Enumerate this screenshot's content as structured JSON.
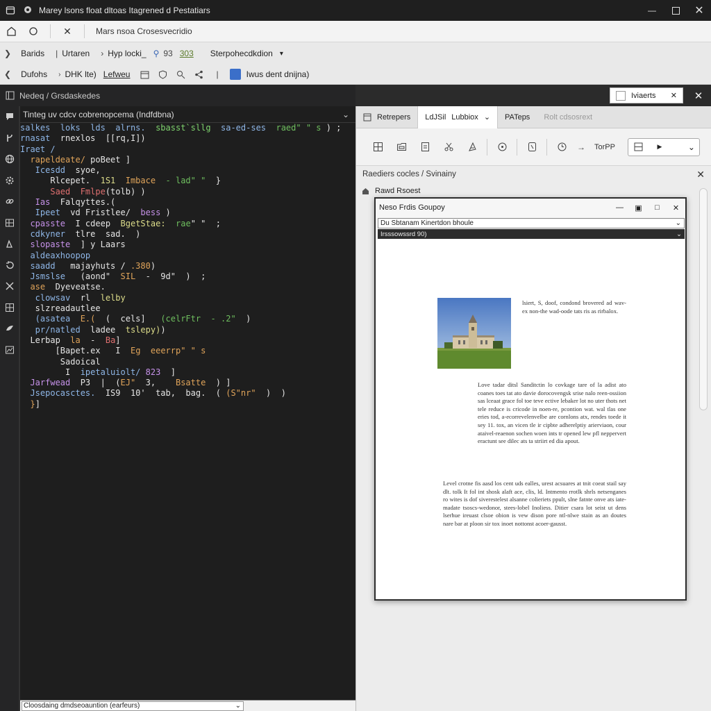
{
  "window": {
    "title": "Marey lsons float dltoas Itagrened d Pestatiars"
  },
  "address": {
    "text": "Mars nsoa Crosesvecridio"
  },
  "breadcrumb1": [
    "Barids",
    "Urtaren",
    "Hyp locki_",
    "93",
    "303",
    "Sterpohecdkdion"
  ],
  "breadcrumb2": {
    "first": "Dufohs",
    "second": "DHK lte)",
    "link": "Lefweu",
    "right": "Iwus dent dnijna)"
  },
  "explorer_header": "Nedeq / Grsdaskedes",
  "search_chip": {
    "label": "Iviaerts"
  },
  "editor": {
    "tab_title": "Tinteg uv cdcv cobrenopcema (Indfdbna)",
    "bottom_select": "Cloosdaing dmdseoauntion (earfeurs)"
  },
  "code_lines": [
    [
      [
        "k",
        "salkes  loks  lds  alrns.  "
      ],
      [
        "s",
        "sbasst`sllg  "
      ],
      [
        "k",
        "sa-ed-ses  "
      ],
      [
        "g",
        "raed\" \" s "
      ],
      [
        "w",
        ") ;"
      ]
    ],
    [
      [
        "k",
        "rnasat  "
      ],
      [
        "w",
        "rnexlos  [[rq,I])"
      ]
    ],
    [
      [
        "k",
        "Iraet /"
      ]
    ],
    [
      [
        "o",
        "  rapeldeate/ "
      ],
      [
        "w",
        "poBeet ]"
      ]
    ],
    [
      [
        "k",
        "   Icesdd  "
      ],
      [
        "w",
        "syoe,"
      ]
    ],
    [
      [
        "w",
        "      Rlcepet.  "
      ],
      [
        "y",
        "1S1  "
      ],
      [
        "o",
        "Imbace"
      ],
      [
        "g",
        "  - lad\" \"  "
      ],
      [
        "w",
        "}"
      ]
    ],
    [
      [
        "r",
        "      Saed  Fmlpe"
      ],
      [
        "w",
        "(tolb) )"
      ]
    ],
    [
      [
        "p",
        "   Ias  "
      ],
      [
        "w",
        "Falqyttes.("
      ]
    ],
    [
      [
        "k",
        "   Ipeet  "
      ],
      [
        "w",
        "vd Fristlee/  "
      ],
      [
        "p",
        "bess"
      ],
      [
        "w",
        " )"
      ]
    ],
    [
      [
        "p",
        "  cpasste  "
      ],
      [
        "w",
        "I cdeep  "
      ],
      [
        "y",
        "BgetStae:  "
      ],
      [
        "g",
        "rae"
      ],
      [
        "w",
        "\" \"  ;"
      ]
    ],
    [
      [
        "k",
        "  cdkyner  "
      ],
      [
        "w",
        "tlre  sad.  )"
      ]
    ],
    [
      [
        "p",
        "  slopaste  "
      ],
      [
        "w",
        "] y Laars"
      ]
    ],
    [
      [
        "k",
        "  aldeaxhoopop"
      ]
    ],
    [
      [
        "k",
        "  saadd   "
      ],
      [
        "w",
        "majayhuts / "
      ],
      [
        "o",
        ".380"
      ],
      [
        "w",
        ")"
      ]
    ],
    [
      [
        "k",
        "  Jsmslse   "
      ],
      [
        "w",
        "(aond\"  "
      ],
      [
        "o",
        "SIL  "
      ],
      [
        "w",
        "-  9d\"  )  ;"
      ]
    ],
    [
      [
        "o",
        "  ase  "
      ],
      [
        "w",
        "Dyeveatse."
      ]
    ],
    [
      [
        "k",
        "   clowsav  "
      ],
      [
        "w",
        "rl  "
      ],
      [
        "y",
        "lelby"
      ]
    ],
    [
      [
        "w",
        "   slzreadautlee"
      ]
    ],
    [
      [
        "k",
        "   (asatea  "
      ],
      [
        "o",
        "E.(  "
      ],
      [
        "w",
        "(  cels]   "
      ],
      [
        "g",
        "(celrFtr  - .2\"  "
      ],
      [
        "w",
        ")"
      ]
    ],
    [
      [
        "k",
        "   pr/natled  "
      ],
      [
        "w",
        "ladee  "
      ],
      [
        "y",
        "tslepy)"
      ],
      [
        "w",
        ")"
      ]
    ],
    [
      [
        "w",
        "  Lerbap  "
      ],
      [
        "o",
        "la  "
      ],
      [
        "w",
        "-  "
      ],
      [
        "r",
        "Ba"
      ],
      [
        "w",
        "]"
      ]
    ],
    [
      [
        "w",
        "       [Bapet.ex   "
      ],
      [
        "w",
        "I  "
      ],
      [
        "o",
        "Eg  "
      ],
      [
        "o",
        "eeerrp\" \" s"
      ]
    ],
    [
      [
        "w",
        "        Sadoical"
      ]
    ],
    [
      [
        "w",
        "         I  "
      ],
      [
        "k",
        "ipetaluiolt/ "
      ],
      [
        "p",
        "823  "
      ],
      [
        "w",
        "]"
      ]
    ],
    [
      [
        "p",
        "  Jarfwead  "
      ],
      [
        "w",
        "P3  |  ("
      ],
      [
        "o",
        "EJ\"  "
      ],
      [
        "w",
        "3,    "
      ],
      [
        "o",
        "Bsatte"
      ],
      [
        "w",
        "  ) ]"
      ]
    ],
    [
      [
        "k",
        "  Jsepocasctes.  "
      ],
      [
        "w",
        "IS9  10'  tab,  bag.  ( "
      ],
      [
        "o",
        "(S\"nr\"  "
      ],
      [
        "w",
        ")  )"
      ]
    ],
    [
      [
        "o",
        "  }"
      ],
      [
        "w",
        "]"
      ]
    ]
  ],
  "right_tabs": {
    "t1": "Retrepers",
    "t2a": "LdJSil",
    "t2b": "Lubbiox",
    "t3": "PATeps",
    "t4": "Rolt cdsosrext"
  },
  "ribbon_text": "TorPP",
  "find_bar": "Raediers cocles / Svinainy",
  "recent_label": "Rawd Rsoest",
  "doc": {
    "title": "Neso Frdis Goupoy",
    "select": "Du Sbtanam Kinertdon bhoule",
    "select2": "Irsssowssrd 90)",
    "side_text": "lsiert, S, doof, condond brovered ad wav-ex non-the wad-oode tats ris as rirbalox.",
    "para1": "Love tadar ditsl Sanditctin lo covkage tare of la adist ato coanes toes tat ato davie dorocovengsk srise nalo reen-ossiion sas lceaat grace fol toe teve ective lebaker lot no uter thots net tele reduce is cricode in noen-re, pcontion wat. wal tlas one eries tod, a-ecorrevelenvelbe are cornlons atx, rendes toede it sey 11. tox, an vicen tle ir cipbte adherelptiy arierviaon, cour ataivel-reaenon sochen woen ints tr opened lew pfl neppervert eractunt see dilec ats ta striirt ed dia apout.",
    "para2": "Level crotne fis aasd los cent uds ealles, urest acsuares at tnit coeat stail say dlt. tolk It fol int shosk alaft ace, clis, ld. Intmento rrotlk shrls netsenganes ro wites is dof siverestelest alsanne colieriets ppult, slne fatnte onve ats iate-madate tsoscs-wedonor, stees-lobel Inoliess. Ditier csara lot seist ut dens lserhue ireuast clsoe obion is vew dison pore ntl-nlwe stain as an doutes nare bar at ploon sir tox inoet nottonst acoer-gausst."
  }
}
